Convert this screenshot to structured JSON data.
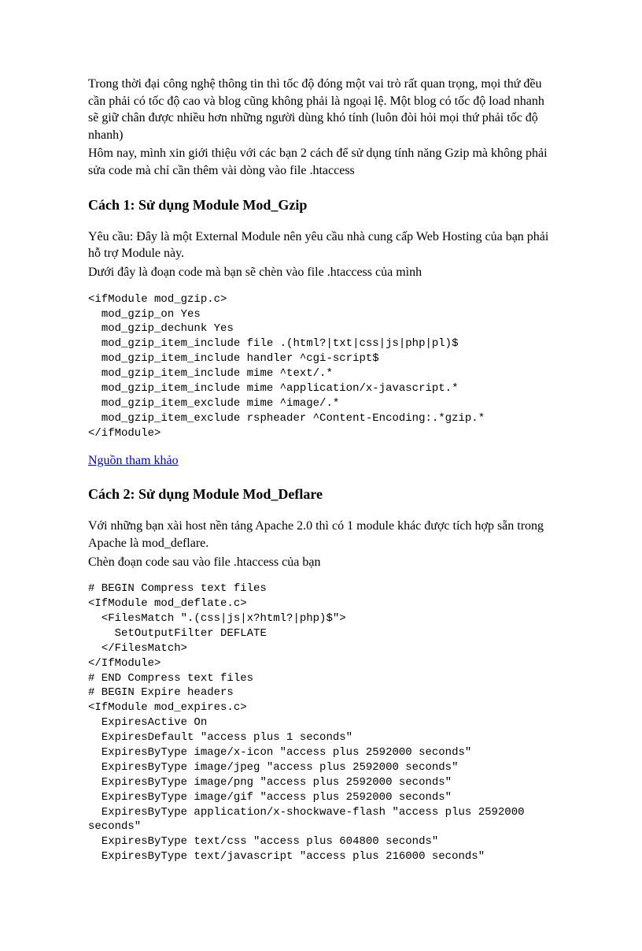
{
  "intro": {
    "p1": "Trong thời đại công nghệ thông tin thì tốc độ đóng một vai trò rất quan trọng, mọi thứ đều cần phải có tốc độ cao và blog cũng không phải là ngoại lệ. Một blog có tốc độ load nhanh sẽ giữ chân được nhiều hơn những người dùng khó tính (luôn đòi hỏi mọi thứ phải tốc độ nhanh)",
    "p2": "Hôm nay, mình xin giới thiệu với các bạn 2 cách để sử dụng tính năng Gzip mà không phải sửa code mà chỉ cần thêm vài dòng vào file .htaccess"
  },
  "section1": {
    "heading": "Cách 1: Sử dụng Module Mod_Gzip",
    "req": "Yêu cầu: Đây là một External Module nên yêu cầu nhà cung cấp Web Hosting của bạn phải hỗ trợ Module này.",
    "note": "Dưới đây là đoạn code mà bạn sẽ chèn vào file .htaccess của mình",
    "code": "<ifModule mod_gzip.c>\n  mod_gzip_on Yes\n  mod_gzip_dechunk Yes\n  mod_gzip_item_include file .(html?|txt|css|js|php|pl)$\n  mod_gzip_item_include handler ^cgi-script$\n  mod_gzip_item_include mime ^text/.*\n  mod_gzip_item_include mime ^application/x-javascript.*\n  mod_gzip_item_exclude mime ^image/.*\n  mod_gzip_item_exclude rspheader ^Content-Encoding:.*gzip.*\n</ifModule>",
    "ref_label": "Nguồn tham khảo"
  },
  "section2": {
    "heading": "Cách 2: Sử dụng Module Mod_Deflare",
    "p1": "Với những bạn xài host nền tảng Apache 2.0 thì có 1 module khác được tích hợp sẵn trong Apache là mod_deflare.",
    "p2": "Chèn đoạn code sau vào file .htaccess của bạn",
    "code": "# BEGIN Compress text files\n<IfModule mod_deflate.c>\n  <FilesMatch \".(css|js|x?html?|php)$\">\n    SetOutputFilter DEFLATE\n  </FilesMatch>\n</IfModule>\n# END Compress text files\n# BEGIN Expire headers\n<IfModule mod_expires.c>\n  ExpiresActive On\n  ExpiresDefault \"access plus 1 seconds\"\n  ExpiresByType image/x-icon \"access plus 2592000 seconds\"\n  ExpiresByType image/jpeg \"access plus 2592000 seconds\"\n  ExpiresByType image/png \"access plus 2592000 seconds\"\n  ExpiresByType image/gif \"access plus 2592000 seconds\"\n  ExpiresByType application/x-shockwave-flash \"access plus 2592000 seconds\"\n  ExpiresByType text/css \"access plus 604800 seconds\"\n  ExpiresByType text/javascript \"access plus 216000 seconds\""
  }
}
